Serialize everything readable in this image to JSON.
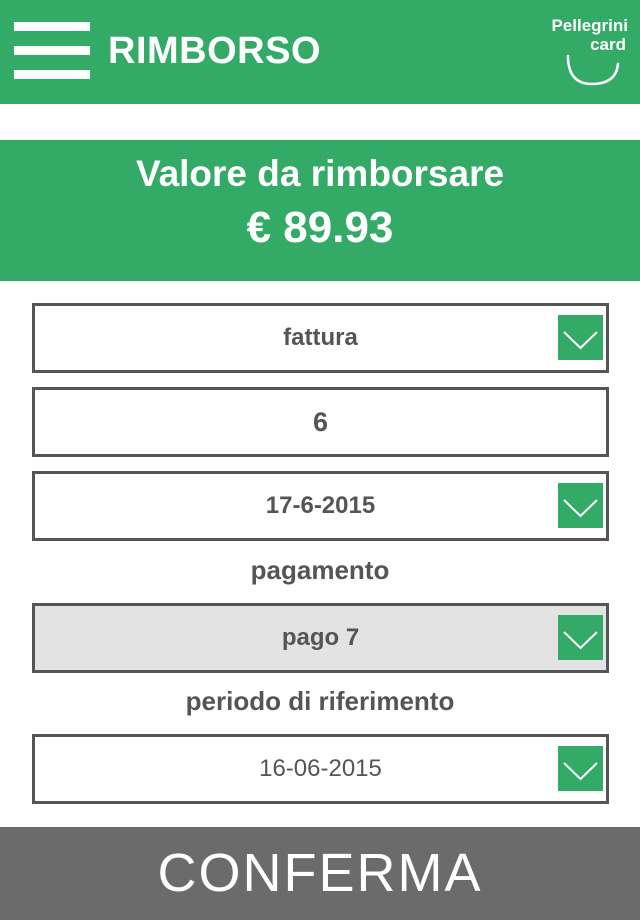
{
  "header": {
    "title": "RIMBORSO",
    "menu_icon": "hamburger-menu-icon",
    "logo": {
      "line1": "Pellegrini",
      "line2": "card"
    }
  },
  "banner": {
    "label": "Valore da rimborsare",
    "amount": "€ 89.93"
  },
  "fields": {
    "document_type": {
      "value": "fattura",
      "icon": "chevron-down-icon"
    },
    "number": {
      "value": "6"
    },
    "date": {
      "value": "17-6-2015",
      "icon": "chevron-down-icon"
    },
    "payment": {
      "label": "pagamento",
      "value": "pago 7",
      "icon": "chevron-down-icon"
    },
    "period": {
      "label": "periodo di riferimento",
      "value": "16-06-2015",
      "icon": "chevron-down-icon"
    }
  },
  "confirm": {
    "label": "CONFERMA"
  },
  "colors": {
    "accent": "#33ab67",
    "text": "#555555",
    "confirm_bg": "#6b6b6b",
    "disabled_bg": "#e3e3e3"
  }
}
